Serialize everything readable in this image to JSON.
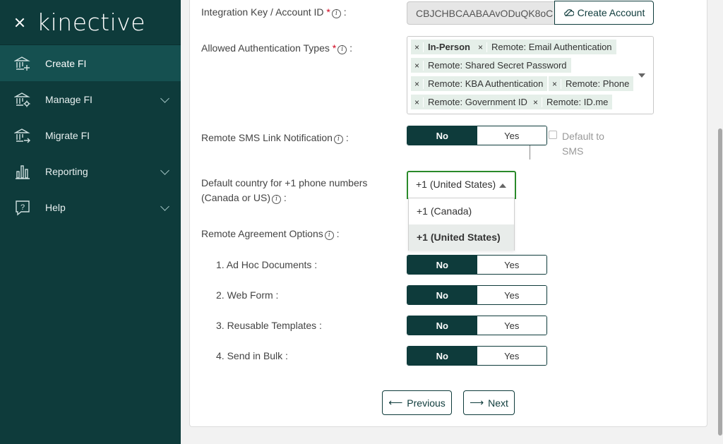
{
  "sidebar": {
    "logo": "kinective",
    "items": [
      {
        "label": "Create FI",
        "icon": "bank-add-icon",
        "active": true
      },
      {
        "label": "Manage FI",
        "icon": "bank-gear-icon",
        "expandable": true
      },
      {
        "label": "Migrate FI",
        "icon": "bank-arrow-icon"
      },
      {
        "label": "Reporting",
        "icon": "bar-chart-icon",
        "expandable": true
      },
      {
        "label": "Help",
        "icon": "help-bubble-icon",
        "expandable": true
      }
    ]
  },
  "form": {
    "integration_key": {
      "label": "Integration Key / Account ID",
      "value": "CBJCHBCAABAAvODuQK8oC",
      "button": "Create Account"
    },
    "auth_types": {
      "label": "Allowed Authentication Types",
      "tags": [
        "In-Person",
        "Remote: Email Authentication",
        "Remote: Shared Secret Password",
        "Remote: KBA Authentication",
        "Remote: Phone",
        "Remote: Government ID",
        "Remote: ID.me"
      ]
    },
    "sms": {
      "label": "Remote SMS Link Notification",
      "no": "No",
      "yes": "Yes",
      "default_label": "Default to SMS"
    },
    "country": {
      "label": "Default country for +1 phone numbers (Canada or US)",
      "selected": "+1 (United States)",
      "options": [
        "+1 (Canada)",
        "+1 (United States)"
      ]
    },
    "agreement": {
      "label": "Remote Agreement Options",
      "items": [
        {
          "label": "1. Ad Hoc Documents :",
          "no": "No",
          "yes": "Yes"
        },
        {
          "label": "2. Web Form :",
          "no": "No",
          "yes": "Yes"
        },
        {
          "label": "3. Reusable Templates :",
          "no": "No",
          "yes": "Yes"
        },
        {
          "label": "4. Send in Bulk :",
          "no": "No",
          "yes": "Yes"
        }
      ]
    },
    "buttons": {
      "previous": "Previous",
      "next": "Next"
    }
  },
  "colors": {
    "sidebar": "#0e3b3b",
    "active_nav": "#155050",
    "tag_bg": "#e5efe9",
    "focus_border": "#2a8a2a"
  }
}
